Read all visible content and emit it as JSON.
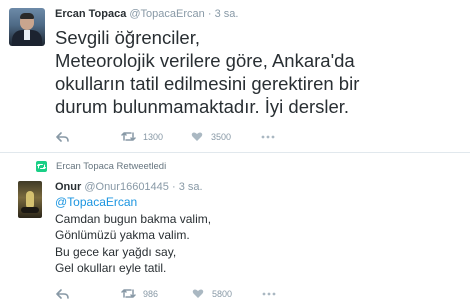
{
  "tweet1": {
    "author_name": "Ercan Topaca",
    "author_handle": "@TopacaErcan",
    "separator": "·",
    "time": "3 sa.",
    "text_lines": [
      "Sevgili öğrenciler,",
      "Meteorolojik verilere göre, Ankara'da",
      "okulların tatil edilmesini  gerektiren bir",
      "durum bulunmamaktadır. İyi dersler."
    ],
    "retweet_count": "1300",
    "like_count": "3500",
    "icons": [
      "reply-icon",
      "retweet-icon",
      "heart-icon",
      "more-icon"
    ]
  },
  "retweet_context": {
    "label": "Ercan Topaca Retweetledi",
    "icon": "retweet-badge-icon"
  },
  "tweet2": {
    "author_name": "Onur",
    "author_handle": "@Onur16601445",
    "separator": "·",
    "time": "3 sa.",
    "mention": "@TopacaErcan",
    "text_lines": [
      "Camdan bugun bakma valim,",
      "Gönlümüzü yakma valim.",
      "Bu gece kar yağdı say,",
      "Gel okulları eyle tatil."
    ],
    "retweet_count": "986",
    "like_count": "5800",
    "icons": [
      "reply-icon",
      "retweet-icon",
      "heart-icon",
      "more-icon"
    ]
  },
  "colors": {
    "text": "#292f33",
    "muted": "#8899a6",
    "link": "#1b95e0",
    "retweet_badge": "#19cf86",
    "divider": "#e1e8ed"
  }
}
